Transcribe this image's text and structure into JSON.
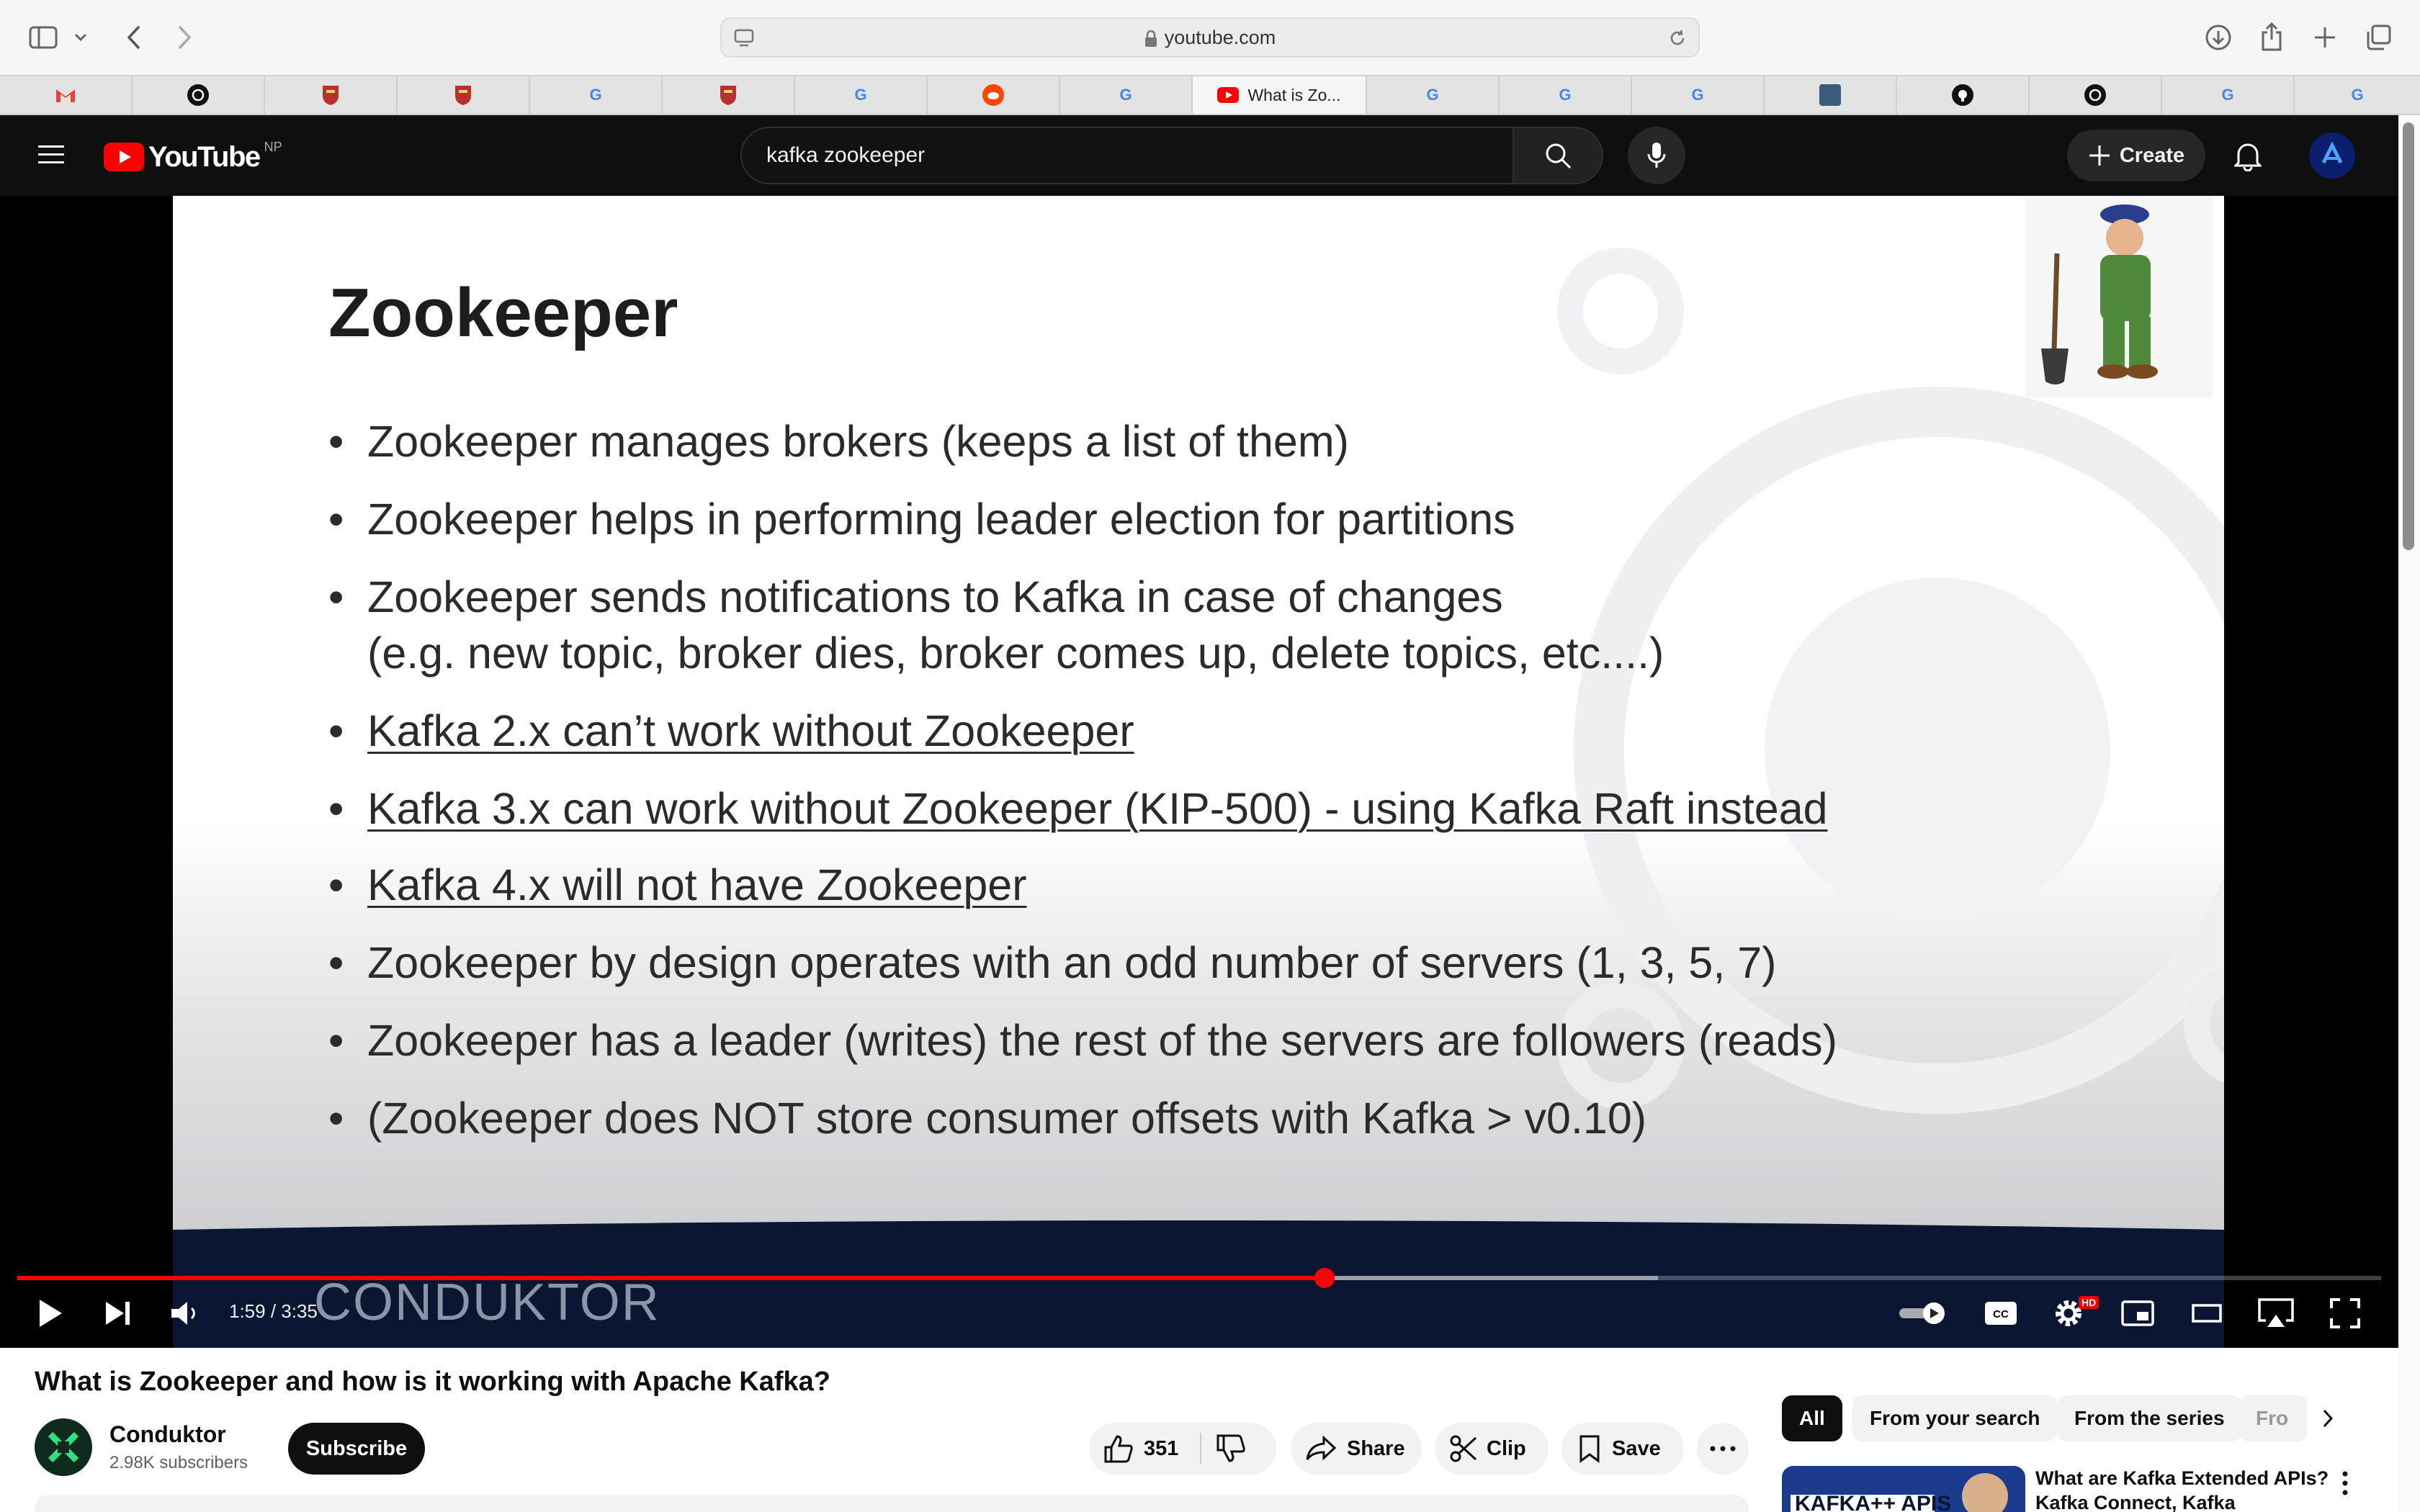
{
  "browser": {
    "address": "youtube.com",
    "active_tab_title": "What is Zo...",
    "tabs": [
      "gmail",
      "openai",
      "cambridge",
      "cambridge",
      "google",
      "cambridge",
      "google",
      "reddit",
      "google",
      "youtube",
      "google",
      "google",
      "google",
      "image",
      "github",
      "openai",
      "google",
      "google"
    ]
  },
  "youtube": {
    "logo_text": "YouTube",
    "region": "NP",
    "search_query": "kafka zookeeper",
    "create_label": "Create"
  },
  "slide": {
    "title": "Zookeeper",
    "bullets": [
      {
        "text": "Zookeeper manages brokers (keeps a list of them)",
        "underline": false
      },
      {
        "text": "Zookeeper helps in performing leader election for partitions",
        "underline": false
      },
      {
        "text": "Zookeeper sends notifications to Kafka in case of changes",
        "underline": false
      },
      {
        "text": "(e.g. new topic, broker dies, broker comes up, delete topics, etc....)",
        "underline": false,
        "continuation": true
      },
      {
        "text": "Kafka 2.x can’t work without Zookeeper",
        "underline": true
      },
      {
        "text": "Kafka 3.x can work without Zookeeper (KIP-500) - using Kafka Raft instead",
        "underline": true
      },
      {
        "text": "Kafka 4.x will not have Zookeeper",
        "underline": true
      },
      {
        "text": "Zookeeper by design operates with an odd number of servers (1, 3, 5, 7)",
        "underline": false
      },
      {
        "text": "Zookeeper has a leader (writes) the rest of the servers are followers (reads)",
        "underline": false
      },
      {
        "text": "(Zookeeper does NOT store consumer offsets with Kafka > v0.10)",
        "underline": false
      }
    ],
    "brand_watermark": "CONDUKTOR"
  },
  "player": {
    "current_time": "1:59",
    "duration": "3:35",
    "time_display": "1:59 / 3:35",
    "played_fraction": 0.553,
    "buffered_fraction": 0.694,
    "hd_badge": "HD"
  },
  "video": {
    "title": "What is Zookeeper and how is it working with Apache Kafka?",
    "channel": "Conduktor",
    "subscribers": "2.98K subscribers",
    "subscribe_label": "Subscribe",
    "likes": "351",
    "share_label": "Share",
    "clip_label": "Clip",
    "save_label": "Save"
  },
  "sidebar": {
    "chips": [
      "All",
      "From your search",
      "From the series",
      "Fro"
    ],
    "next_video_title": "What are Kafka Extended APIs? Kafka Connect, Kafka Streams...",
    "next_thumb_text": "KAFKA++ APIS"
  }
}
